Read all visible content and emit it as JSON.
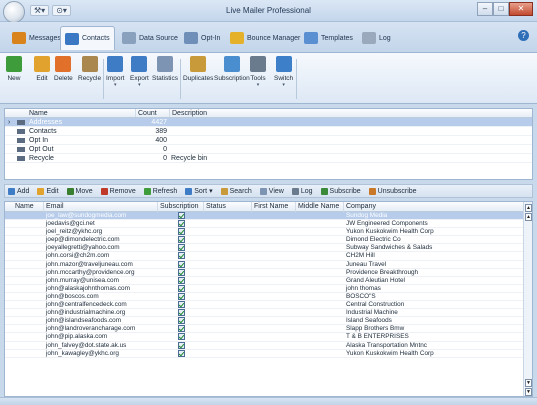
{
  "app": {
    "title": "Live Mailer Professional"
  },
  "window_buttons": {
    "minimize": "–",
    "maximize": "□",
    "close": "✕"
  },
  "quick_access": [
    "⚒▾",
    "⊙▾"
  ],
  "tabs": [
    {
      "label": "Messages",
      "color": "#d9831c"
    },
    {
      "label": "Contacts",
      "color": "#3a78c4",
      "active": true
    },
    {
      "label": "Data Source",
      "color": "#8aa1bd"
    },
    {
      "label": "Opt-In",
      "color": "#6f8fb8"
    },
    {
      "label": "Bounce Manager",
      "color": "#e6b12a"
    },
    {
      "label": "Templates",
      "color": "#5a8fd1"
    },
    {
      "label": "Log",
      "color": "#9aa9bb"
    }
  ],
  "help": "?",
  "ribbon": [
    {
      "label": "New",
      "color": "#3e9c3a"
    },
    {
      "label": "Edit",
      "color": "#e1a32e"
    },
    {
      "label": "Delete",
      "color": "#e0702a"
    },
    {
      "label": "Recycle",
      "color": "#a9874f"
    },
    {
      "label": "Import",
      "color": "#3f7cc6",
      "dropdown": true
    },
    {
      "label": "Export",
      "color": "#3f7cc6",
      "dropdown": true
    },
    {
      "label": "Statistics",
      "color": "#7d94b3"
    },
    {
      "label": "Duplicates",
      "color": "#c99a3a"
    },
    {
      "label": "Subscription",
      "color": "#4b8ecf"
    },
    {
      "label": "Tools",
      "color": "#6b7b8e",
      "dropdown": true
    },
    {
      "label": "Switch",
      "color": "#3d7fc8",
      "dropdown": true
    }
  ],
  "groups_grid": {
    "columns": [
      "Name",
      "Count",
      "Description"
    ],
    "rows": [
      {
        "name": "Addresses",
        "count": "4427",
        "description": "",
        "selected": true
      },
      {
        "name": "Contacts",
        "count": "389",
        "description": ""
      },
      {
        "name": "Opt In",
        "count": "400",
        "description": ""
      },
      {
        "name": "Opt Out",
        "count": "0",
        "description": ""
      },
      {
        "name": "Recycle",
        "count": "0",
        "description": "Recycle bin"
      }
    ]
  },
  "toolbar": [
    "Add",
    "Edit",
    "Move",
    "Remove",
    "Refresh",
    "Sort",
    "Search",
    "View",
    "Log",
    "Subscribe",
    "Unsubscribe"
  ],
  "toolbar_colors": [
    "#3f7cc6",
    "#e1a32e",
    "#3a7f2f",
    "#c03a2a",
    "#3f9c3a",
    "#3f7cc6",
    "#c99a3a",
    "#7d94b3",
    "#6b7b8e",
    "#3a8a3a",
    "#c9782a"
  ],
  "contacts_grid": {
    "columns": [
      "Name",
      "Email",
      "Subscription",
      "Status",
      "First Name",
      "Middle Name",
      "Company"
    ],
    "rows": [
      {
        "email": "joe_law@sundogmedia.com",
        "subscribed": true,
        "company": "Sundog Media",
        "selected": true
      },
      {
        "email": "joedavis@gci.net",
        "subscribed": true,
        "company": "JW Engineered Components"
      },
      {
        "email": "joel_reitz@ykhc.org",
        "subscribed": true,
        "company": "Yukon Kuskokwim Health Corp"
      },
      {
        "email": "joep@dimondelectric.com",
        "subscribed": true,
        "company": "Dimond Electric Co"
      },
      {
        "email": "joeyallegretti@yahoo.com",
        "subscribed": true,
        "company": "Subway Sandwiches & Salads"
      },
      {
        "email": "john.corsi@ch2m.com",
        "subscribed": true,
        "company": "CH2M Hill"
      },
      {
        "email": "john.mazor@traveljuneau.com",
        "subscribed": true,
        "company": "Juneau Travel"
      },
      {
        "email": "john.mccarthy@providence.org",
        "subscribed": true,
        "company": "Providence Breakthrough"
      },
      {
        "email": "john.murray@unisea.com",
        "subscribed": true,
        "company": "Grand Aleutian Hotel"
      },
      {
        "email": "john@alaskajohnthomas.com",
        "subscribed": true,
        "company": "john thomas"
      },
      {
        "email": "john@boscos.com",
        "subscribed": true,
        "company": "BOSCO\"S"
      },
      {
        "email": "john@centralfencedeck.com",
        "subscribed": true,
        "company": "Central Construction"
      },
      {
        "email": "john@industrialmachine.org",
        "subscribed": true,
        "company": "Industrial Machine"
      },
      {
        "email": "john@islandseafoods.com",
        "subscribed": true,
        "company": "Island Seafoods"
      },
      {
        "email": "john@landroverancharage.com",
        "subscribed": true,
        "company": "Slapp Brothers Bmw"
      },
      {
        "email": "john@pip.alaska.com",
        "subscribed": true,
        "company": "T & B ENTERPRISES"
      },
      {
        "email": "john_falvey@dot.state.ak.us",
        "subscribed": true,
        "company": "Alaska Transportation Mntnc"
      },
      {
        "email": "john_kawagley@ykhc.org",
        "subscribed": true,
        "company": "Yukon Kuskokwim Health Corp"
      }
    ]
  }
}
